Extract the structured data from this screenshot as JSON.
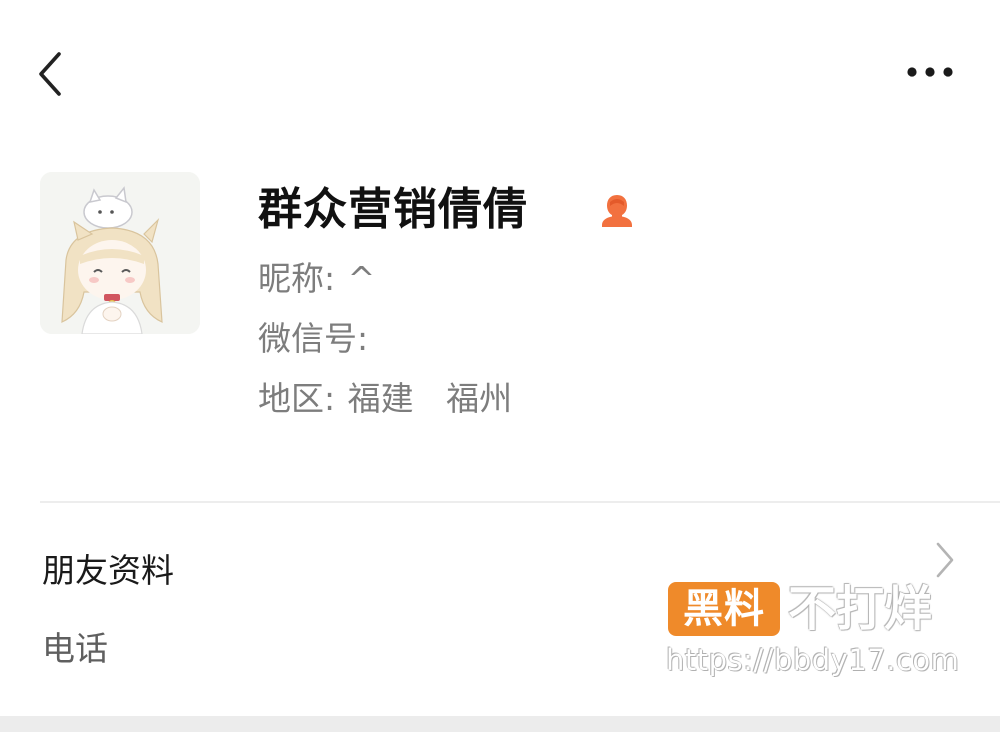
{
  "header": {
    "back_icon": "chevron-left-icon",
    "more_icon": "ellipsis-icon"
  },
  "profile": {
    "display_name": "群众营销倩倩",
    "gender_icon": "female-person-icon",
    "gender_color": "#f2713f",
    "nickname_label": "昵称:",
    "nickname_value": "^",
    "wechat_id_label": "微信号:",
    "wechat_id_value": "",
    "region_label": "地区:",
    "region_province": "福建",
    "region_city": "福州"
  },
  "details": {
    "friend_info_label": "朋友资料",
    "phone_label": "电话"
  },
  "watermark": {
    "badge_text": "黑料",
    "tagline": "不打烊",
    "url": "https://bbdy17.com",
    "badge_color": "#ef8a2a"
  }
}
